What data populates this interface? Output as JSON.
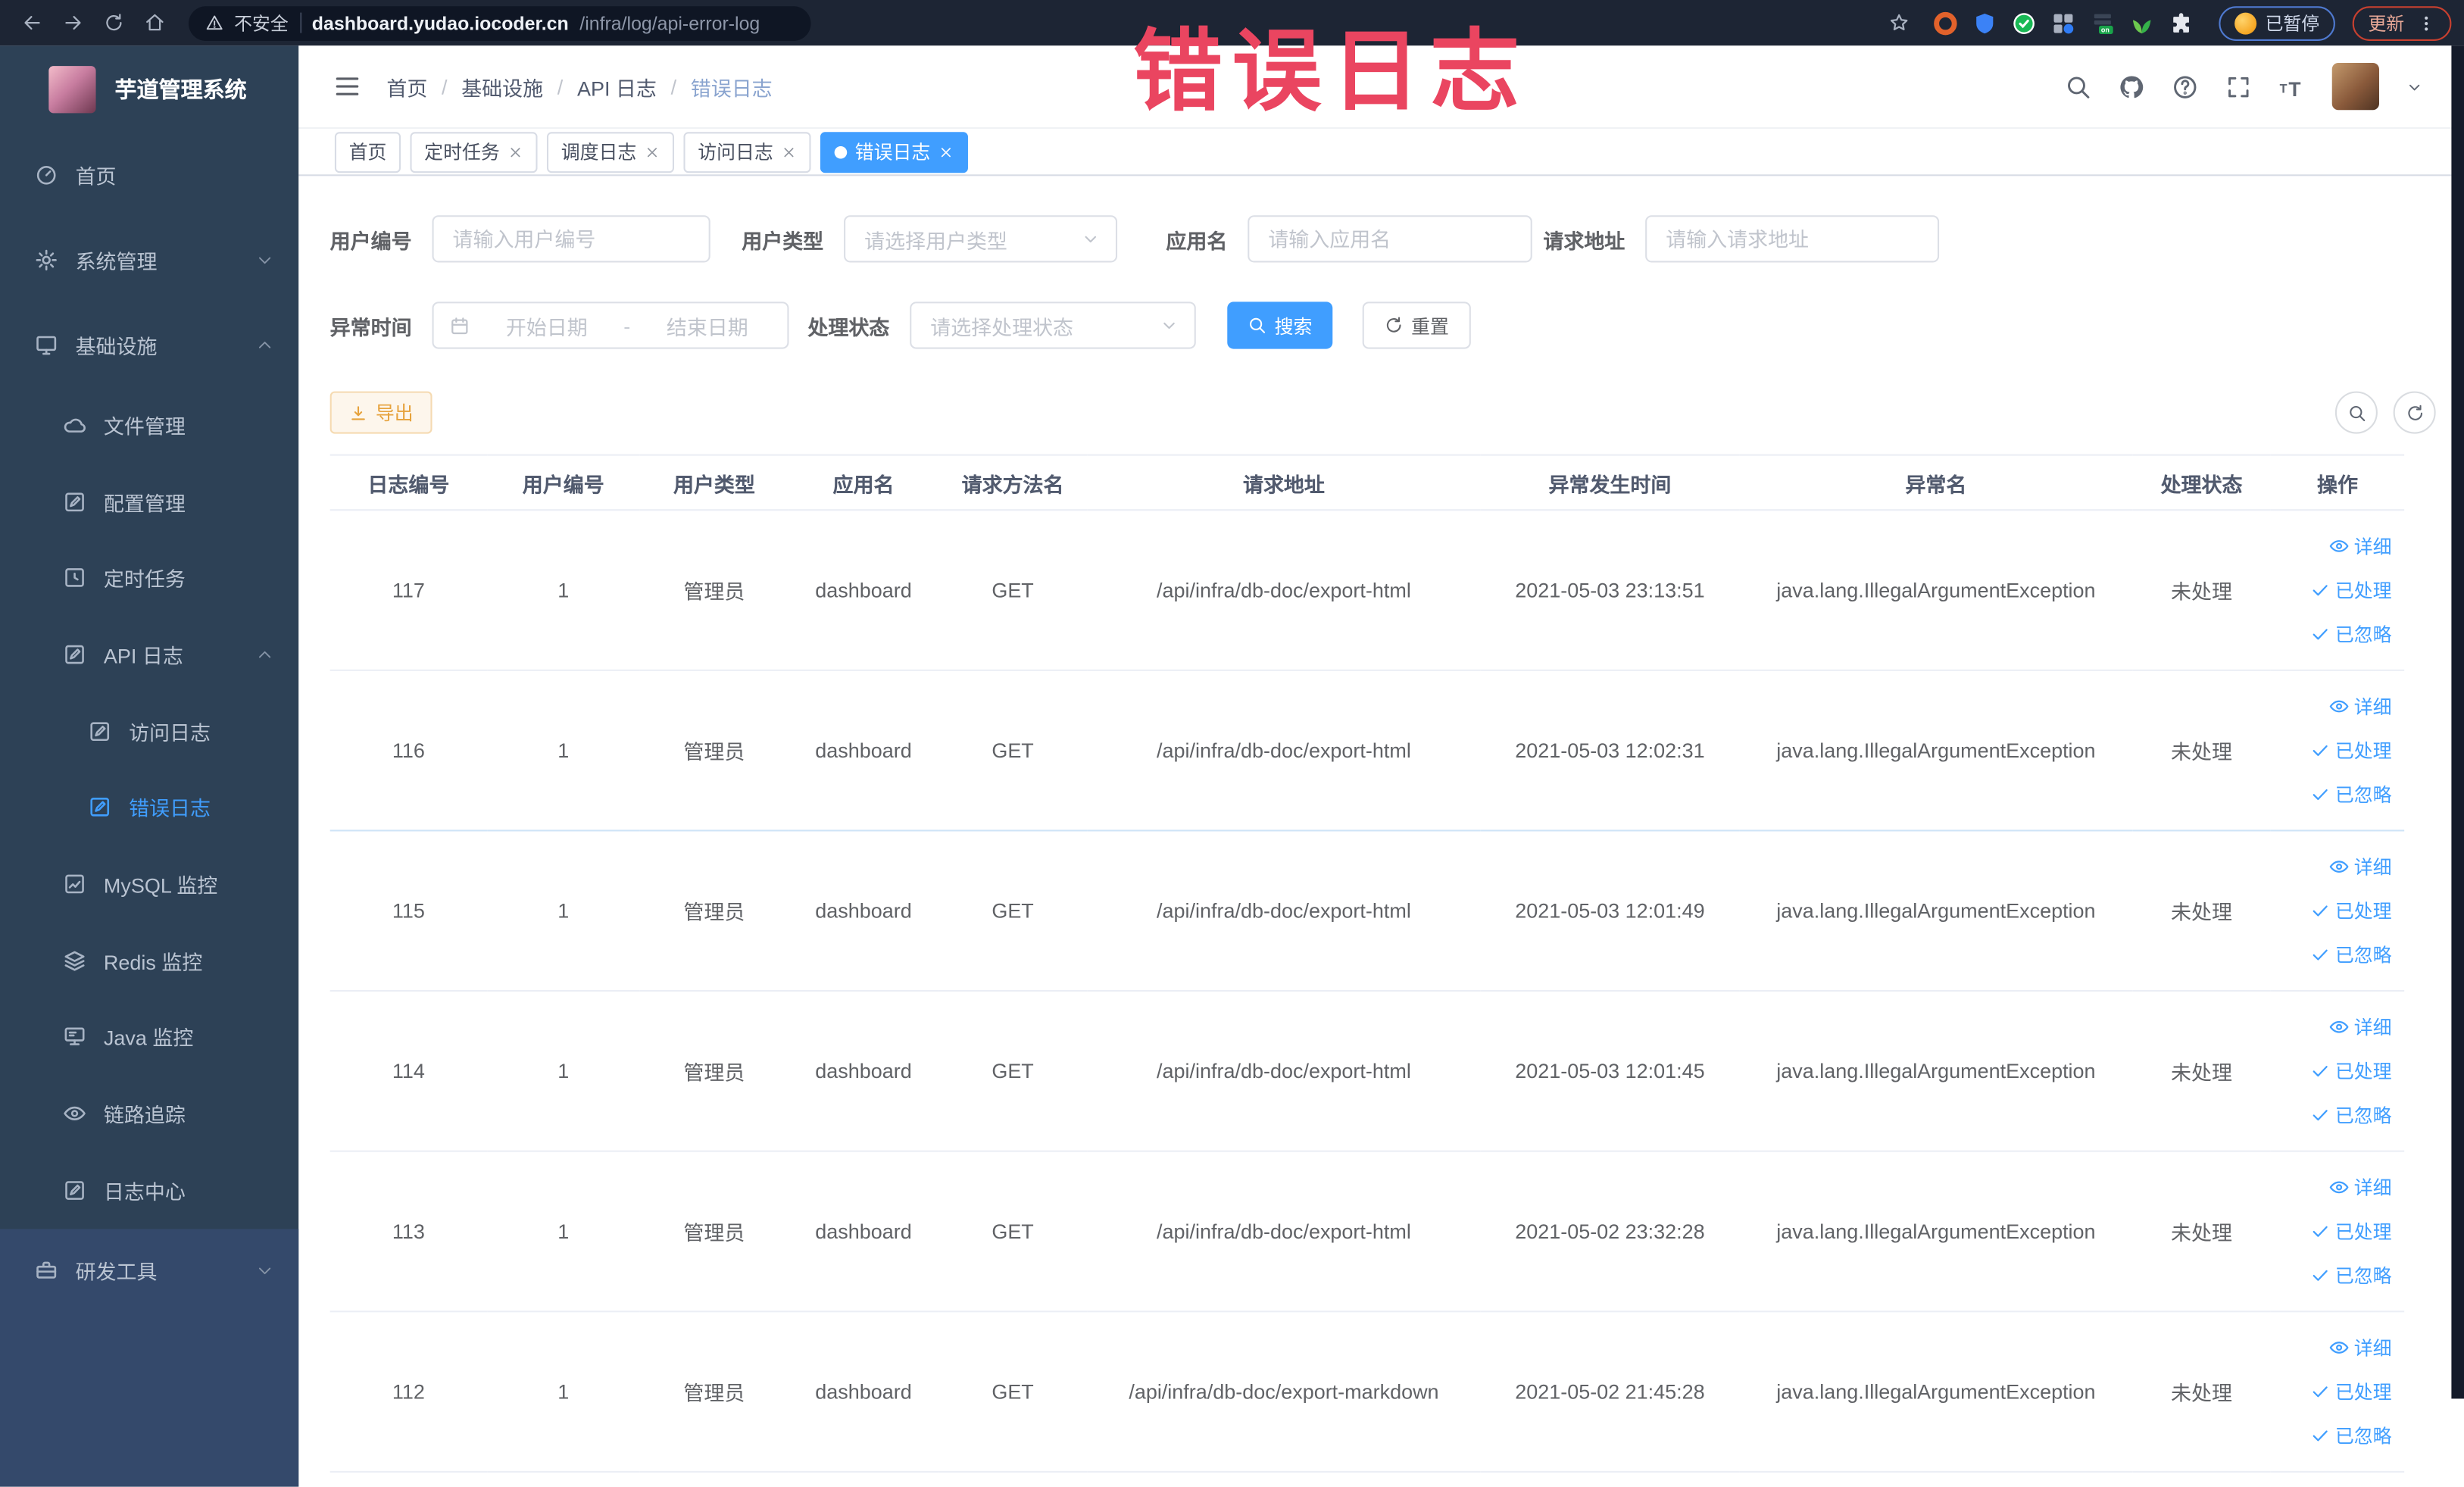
{
  "browser": {
    "security_label": "不安全",
    "url_host": "dashboard.yudao.iocoder.cn",
    "url_path": "/infra/log/api-error-log",
    "nav_icons": [
      "back-icon",
      "forward-icon",
      "reload-icon",
      "home-icon",
      "bookmark-star-icon"
    ],
    "extension_icons": [
      "orange-ring-extension-icon",
      "blue-shield-extension-icon",
      "green-check-extension-icon",
      "grid-extension-icon",
      "on-toggle-extension-icon",
      "leaf-extension-icon",
      "puzzle-extension-icon"
    ],
    "profile_status": "已暂停",
    "update_button": "更新"
  },
  "overlay": {
    "text": "错误日志",
    "color": "#ea4560"
  },
  "sidebar": {
    "app_title": "芋道管理系统",
    "items": [
      {
        "name": "home",
        "label": "首页",
        "icon": "dashboard-icon",
        "level": 0
      },
      {
        "name": "system",
        "label": "系统管理",
        "icon": "gear-icon",
        "level": 0,
        "chevron": "down"
      },
      {
        "name": "infra",
        "label": "基础设施",
        "icon": "monitor-icon",
        "level": 0,
        "chevron": "up"
      },
      {
        "name": "file",
        "label": "文件管理",
        "icon": "cloud-icon",
        "level": 1
      },
      {
        "name": "config",
        "label": "配置管理",
        "icon": "edit-icon",
        "level": 1
      },
      {
        "name": "job",
        "label": "定时任务",
        "icon": "timer-icon",
        "level": 1
      },
      {
        "name": "api-log",
        "label": "API 日志",
        "icon": "log-icon",
        "level": 1,
        "chevron": "up"
      },
      {
        "name": "access-log",
        "label": "访问日志",
        "icon": "log-icon",
        "level": 2
      },
      {
        "name": "error-log",
        "label": "错误日志",
        "icon": "log-icon",
        "level": 2,
        "active": true
      },
      {
        "name": "mysql",
        "label": "MySQL 监控",
        "icon": "chart-icon",
        "level": 1
      },
      {
        "name": "redis",
        "label": "Redis 监控",
        "icon": "layers-icon",
        "level": 1
      },
      {
        "name": "java",
        "label": "Java 监控",
        "icon": "java-icon",
        "level": 1
      },
      {
        "name": "trace",
        "label": "链路追踪",
        "icon": "eye-icon",
        "level": 1
      },
      {
        "name": "log-center",
        "label": "日志中心",
        "icon": "log-icon",
        "level": 1
      },
      {
        "name": "dev-tools",
        "label": "研发工具",
        "icon": "briefcase-icon",
        "level": 0,
        "chevron": "down",
        "section": "bottom"
      }
    ]
  },
  "header": {
    "breadcrumb": [
      "首页",
      "基础设施",
      "API 日志",
      "错误日志"
    ],
    "right_icons": [
      "search-icon",
      "github-icon",
      "question-icon",
      "fullscreen-icon",
      "fontsize-icon",
      "avatar",
      "caret-down-icon"
    ]
  },
  "tabs": [
    {
      "label": "首页"
    },
    {
      "label": "定时任务",
      "closable": true
    },
    {
      "label": "调度日志",
      "closable": true
    },
    {
      "label": "访问日志",
      "closable": true
    },
    {
      "label": "错误日志",
      "closable": true,
      "active": true
    }
  ],
  "filters": {
    "fields": [
      {
        "label": "用户编号",
        "placeholder": "请输入用户编号",
        "type": "input"
      },
      {
        "label": "用户类型",
        "placeholder": "请选择用户类型",
        "type": "select"
      },
      {
        "label": "应用名",
        "placeholder": "请输入应用名",
        "type": "input"
      },
      {
        "label": "请求地址",
        "placeholder": "请输入请求地址",
        "type": "input"
      },
      {
        "label": "异常时间",
        "type": "daterange",
        "start_placeholder": "开始日期",
        "separator": "-",
        "end_placeholder": "结束日期"
      },
      {
        "label": "处理状态",
        "placeholder": "请选择处理状态",
        "type": "select"
      }
    ],
    "search_button": "搜索",
    "reset_button": "重置"
  },
  "toolbar": {
    "export_button": "导出",
    "icon_buttons": [
      "search-icon",
      "refresh-icon"
    ]
  },
  "table": {
    "columns": [
      "日志编号",
      "用户编号",
      "用户类型",
      "应用名",
      "请求方法名",
      "请求地址",
      "异常发生时间",
      "异常名",
      "处理状态",
      "操作"
    ],
    "row_actions": [
      {
        "label": "详细",
        "icon": "eye-icon"
      },
      {
        "label": "已处理",
        "icon": "check-icon"
      },
      {
        "label": "已忽略",
        "icon": "check-icon"
      }
    ],
    "rows": [
      {
        "id": "117",
        "user_id": "1",
        "user_type": "管理员",
        "app": "dashboard",
        "method": "GET",
        "url": "/api/infra/db-doc/export-html",
        "time": "2021-05-03 23:13:51",
        "exception": "java.lang.IllegalArgumentException",
        "status": "未处理"
      },
      {
        "id": "116",
        "user_id": "1",
        "user_type": "管理员",
        "app": "dashboard",
        "method": "GET",
        "url": "/api/infra/db-doc/export-html",
        "time": "2021-05-03 12:02:31",
        "exception": "java.lang.IllegalArgumentException",
        "status": "未处理"
      },
      {
        "id": "115",
        "user_id": "1",
        "user_type": "管理员",
        "app": "dashboard",
        "method": "GET",
        "url": "/api/infra/db-doc/export-html",
        "time": "2021-05-03 12:01:49",
        "exception": "java.lang.IllegalArgumentException",
        "status": "未处理"
      },
      {
        "id": "114",
        "user_id": "1",
        "user_type": "管理员",
        "app": "dashboard",
        "method": "GET",
        "url": "/api/infra/db-doc/export-html",
        "time": "2021-05-03 12:01:45",
        "exception": "java.lang.IllegalArgumentException",
        "status": "未处理"
      },
      {
        "id": "113",
        "user_id": "1",
        "user_type": "管理员",
        "app": "dashboard",
        "method": "GET",
        "url": "/api/infra/db-doc/export-html",
        "time": "2021-05-02 23:32:28",
        "exception": "java.lang.IllegalArgumentException",
        "status": "未处理"
      },
      {
        "id": "112",
        "user_id": "1",
        "user_type": "管理员",
        "app": "dashboard",
        "method": "GET",
        "url": "/api/infra/db-doc/export-markdown",
        "time": "2021-05-02 21:45:28",
        "exception": "java.lang.IllegalArgumentException",
        "status": "未处理"
      }
    ]
  },
  "colors": {
    "primary": "#409eff",
    "overlay_red": "#ea4560",
    "warning": "#e6a23c",
    "sidebar_bg": "#2d4156",
    "sidebar_bottom_bg": "#34496b",
    "chrome_bg": "#1d2534"
  }
}
